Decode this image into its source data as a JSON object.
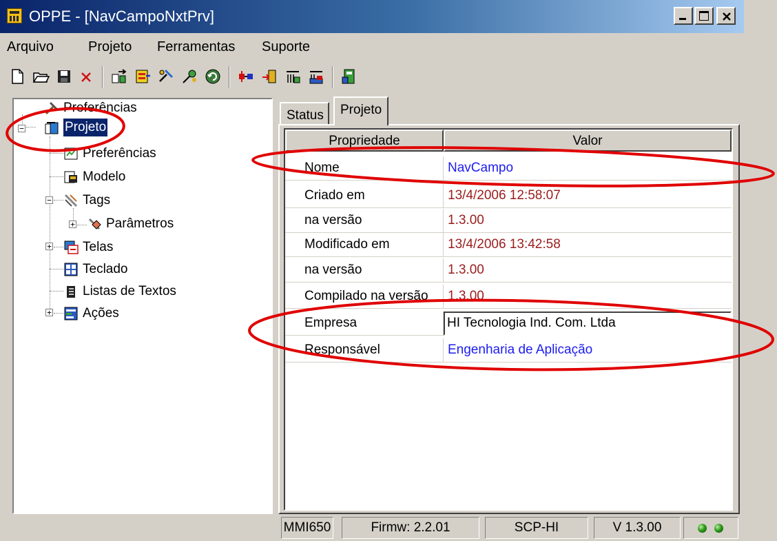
{
  "window": {
    "title": "OPPE - [NavCampoNxtPrv]",
    "controls": {
      "minimize": "minimize-icon",
      "maximize": "maximize-icon",
      "close": "close-icon"
    }
  },
  "menu": [
    "Arquivo",
    "Projeto",
    "Ferramentas",
    "Suporte"
  ],
  "toolbar": {
    "buttons": [
      "new-file-icon",
      "open-folder-icon",
      "save-disk-icon",
      "delete-x-icon",
      "import-icon",
      "export-icon",
      "tools-icon",
      "settings-icon",
      "refresh-icon",
      "connect-icon",
      "transfer-icon",
      "download-icon",
      "upload-icon",
      "project-info-icon"
    ]
  },
  "tree": {
    "items": [
      {
        "label": "Preferências",
        "icon": "tools-icon"
      },
      {
        "label": "Projeto",
        "icon": "project-icon",
        "selected": true
      },
      {
        "label": "Preferências",
        "icon": "preferences-icon"
      },
      {
        "label": "Modelo",
        "icon": "model-icon"
      },
      {
        "label": "Tags",
        "icon": "tags-icon"
      },
      {
        "label": "Parâmetros",
        "icon": "parameters-icon"
      },
      {
        "label": "Telas",
        "icon": "screens-icon"
      },
      {
        "label": "Teclado",
        "icon": "keyboard-icon"
      },
      {
        "label": "Listas de Textos",
        "icon": "text-list-icon"
      },
      {
        "label": "Ações",
        "icon": "actions-icon"
      }
    ]
  },
  "tabs": [
    "Status",
    "Projeto"
  ],
  "grid": {
    "headers": [
      "Propriedade",
      "Valor"
    ],
    "rows": [
      {
        "name": "Nome",
        "value": "NavCampo"
      },
      {
        "name": "Criado em",
        "value": "13/4/2006 12:58:07"
      },
      {
        "name": "na versão",
        "value": "1.3.00"
      },
      {
        "name": "Modificado em",
        "value": "13/4/2006 13:42:58"
      },
      {
        "name": "na versão",
        "value": "1.3.00"
      },
      {
        "name": "Compilado na versão",
        "value": "1.3.00"
      },
      {
        "name": "Empresa",
        "value": "HI Tecnologia Ind. Com. Ltda"
      },
      {
        "name": "Responsável",
        "value": "Engenharia de Aplicação"
      }
    ]
  },
  "statusbar": {
    "model": "MMI650",
    "firmware": "Firmw: 2.2.01",
    "protocol": "SCP-HI",
    "version": "V 1.3.00",
    "leds": [
      "status-led-green",
      "status-led-green"
    ]
  },
  "colors": {
    "titlebar_start": "#0a246a",
    "titlebar_end": "#a6caf0",
    "value_blue": "#1c1cf0",
    "value_red": "#9b1c1c",
    "annotation_red": "#e00000"
  }
}
